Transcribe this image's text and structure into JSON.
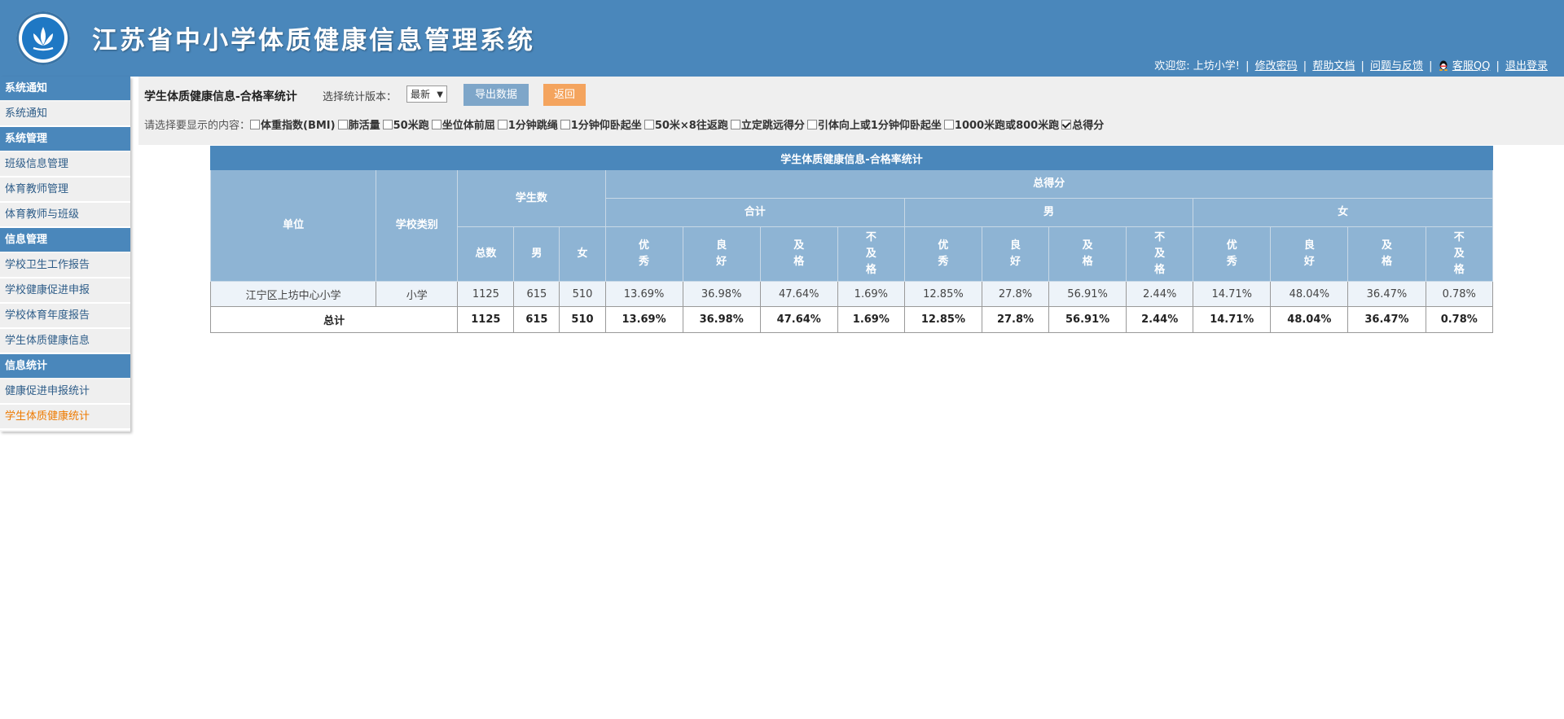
{
  "header": {
    "title": "江苏省中小学体质健康信息管理系统",
    "welcome": "欢迎您: 上坊小学!",
    "links": [
      "修改密码",
      "帮助文档",
      "问题与反馈",
      "客服QQ",
      "退出登录"
    ]
  },
  "sidebar": {
    "sections": [
      {
        "title": "系统通知",
        "items": [
          "系统通知"
        ]
      },
      {
        "title": "系统管理",
        "items": [
          "班级信息管理",
          "体育教师管理",
          "体育教师与班级"
        ]
      },
      {
        "title": "信息管理",
        "items": [
          "学校卫生工作报告",
          "学校健康促进申报",
          "学校体育年度报告",
          "学生体质健康信息"
        ]
      },
      {
        "title": "信息统计",
        "items": [
          "健康促进申报统计",
          "学生体质健康统计"
        ]
      }
    ],
    "active_item": "学生体质健康统计"
  },
  "toolbar": {
    "title": "学生体质健康信息-合格率统计",
    "version_label": "选择统计版本：",
    "version_value": "最新",
    "export_label": "导出数据",
    "back_label": "返回",
    "filter_prompt": "请选择要显示的内容：",
    "filters": [
      {
        "label": "体重指数(BMI)",
        "checked": false
      },
      {
        "label": "肺活量",
        "checked": false
      },
      {
        "label": "50米跑",
        "checked": false
      },
      {
        "label": "坐位体前屈",
        "checked": false
      },
      {
        "label": "1分钟跳绳",
        "checked": false
      },
      {
        "label": "1分钟仰卧起坐",
        "checked": false
      },
      {
        "label": "50米×8往返跑",
        "checked": false
      },
      {
        "label": "立定跳远得分",
        "checked": false
      },
      {
        "label": "引体向上或1分钟仰卧起坐",
        "checked": false
      },
      {
        "label": "1000米跑或800米跑",
        "checked": false
      },
      {
        "label": "总得分",
        "checked": true
      }
    ]
  },
  "table": {
    "caption": "学生体质健康信息-合格率统计",
    "h_unit": "单位",
    "h_school_type": "学校类别",
    "h_students": "学生数",
    "h_total_score": "总得分",
    "h_combined": "合计",
    "h_male": "男",
    "h_female": "女",
    "h_count_total": "总数",
    "h_count_male": "男",
    "h_count_female": "女",
    "grades": [
      "优\n秀",
      "良\n好",
      "及\n格",
      "不\n及\n格"
    ],
    "rows": [
      {
        "unit": "江宁区上坊中心小学",
        "type": "小学",
        "total": "1125",
        "male": "615",
        "female": "510",
        "values": [
          "13.69%",
          "36.98%",
          "47.64%",
          "1.69%",
          "12.85%",
          "27.8%",
          "56.91%",
          "2.44%",
          "14.71%",
          "48.04%",
          "36.47%",
          "0.78%"
        ]
      }
    ],
    "total_row": {
      "label": "总计",
      "total": "1125",
      "male": "615",
      "female": "510",
      "values": [
        "13.69%",
        "36.98%",
        "47.64%",
        "1.69%",
        "12.85%",
        "27.8%",
        "56.91%",
        "2.44%",
        "14.71%",
        "48.04%",
        "36.47%",
        "0.78%"
      ]
    }
  }
}
